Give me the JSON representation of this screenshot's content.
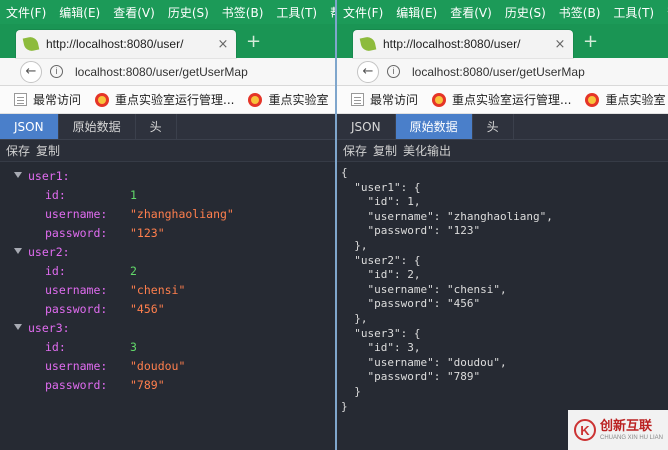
{
  "menu": [
    "文件(F)",
    "编辑(E)",
    "查看(V)",
    "历史(S)",
    "书签(B)",
    "工具(T)",
    "帮"
  ],
  "tab": {
    "title": "http://localhost:8080/user/",
    "close": "×",
    "new_tab": "+"
  },
  "nav": {
    "url": "localhost:8080/user/getUserMap"
  },
  "bookmarks": [
    "最常访问",
    "重点实验室运行管理...",
    "重点实验室"
  ],
  "devtools": {
    "tabs": [
      "JSON",
      "原始数据",
      "头"
    ],
    "left_toolbar": [
      "保存",
      "复制"
    ],
    "right_toolbar": [
      "保存",
      "复制",
      "美化输出"
    ]
  },
  "json_tree": [
    {
      "key": "user1:",
      "fields": [
        {
          "k": "id:",
          "v": "1",
          "t": "num"
        },
        {
          "k": "username:",
          "v": "\"zhanghaoliang\"",
          "t": "str"
        },
        {
          "k": "password:",
          "v": "\"123\"",
          "t": "str"
        }
      ]
    },
    {
      "key": "user2:",
      "fields": [
        {
          "k": "id:",
          "v": "2",
          "t": "num"
        },
        {
          "k": "username:",
          "v": "\"chensi\"",
          "t": "str"
        },
        {
          "k": "password:",
          "v": "\"456\"",
          "t": "str"
        }
      ]
    },
    {
      "key": "user3:",
      "fields": [
        {
          "k": "id:",
          "v": "3",
          "t": "num"
        },
        {
          "k": "username:",
          "v": "\"doudou\"",
          "t": "str"
        },
        {
          "k": "password:",
          "v": "\"789\"",
          "t": "str"
        }
      ]
    }
  ],
  "raw_lines": [
    "{",
    "  \"user1\": {",
    "    \"id\": 1,",
    "    \"username\": \"zhanghaoliang\",",
    "    \"password\": \"123\"",
    "  },",
    "  \"user2\": {",
    "    \"id\": 2,",
    "    \"username\": \"chensi\",",
    "    \"password\": \"456\"",
    "  },",
    "  \"user3\": {",
    "    \"id\": 3,",
    "    \"username\": \"doudou\",",
    "    \"password\": \"789\"",
    "  }",
    "}"
  ],
  "watermark": {
    "logo": "K",
    "cn": "创新互联",
    "en": "CHUANG XIN HU LIAN"
  }
}
